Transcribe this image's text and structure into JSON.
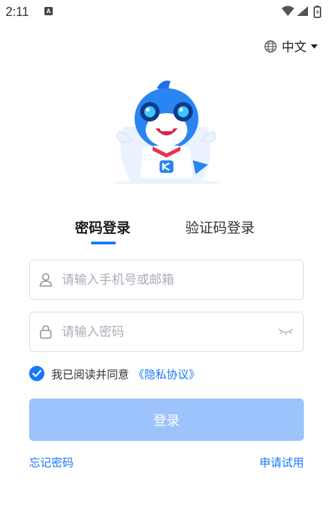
{
  "status_bar": {
    "time": "2:11",
    "notification_letter": "A"
  },
  "language": {
    "label": "中文"
  },
  "tabs": [
    {
      "label": "密码登录",
      "active": true
    },
    {
      "label": "验证码登录",
      "active": false
    }
  ],
  "form": {
    "username_placeholder": "请输入手机号或邮箱",
    "password_placeholder": "请输入密码"
  },
  "agreement": {
    "checked": true,
    "text": "我已阅读并同意",
    "link": "《隐私协议》"
  },
  "login_button": "登录",
  "footer_links": {
    "forgot": "忘记密码",
    "trial": "申请试用"
  },
  "colors": {
    "accent": "#1677ff",
    "button_disabled": "#9cc3fb",
    "border": "#d9dde4",
    "placeholder": "#a9aeb8"
  }
}
